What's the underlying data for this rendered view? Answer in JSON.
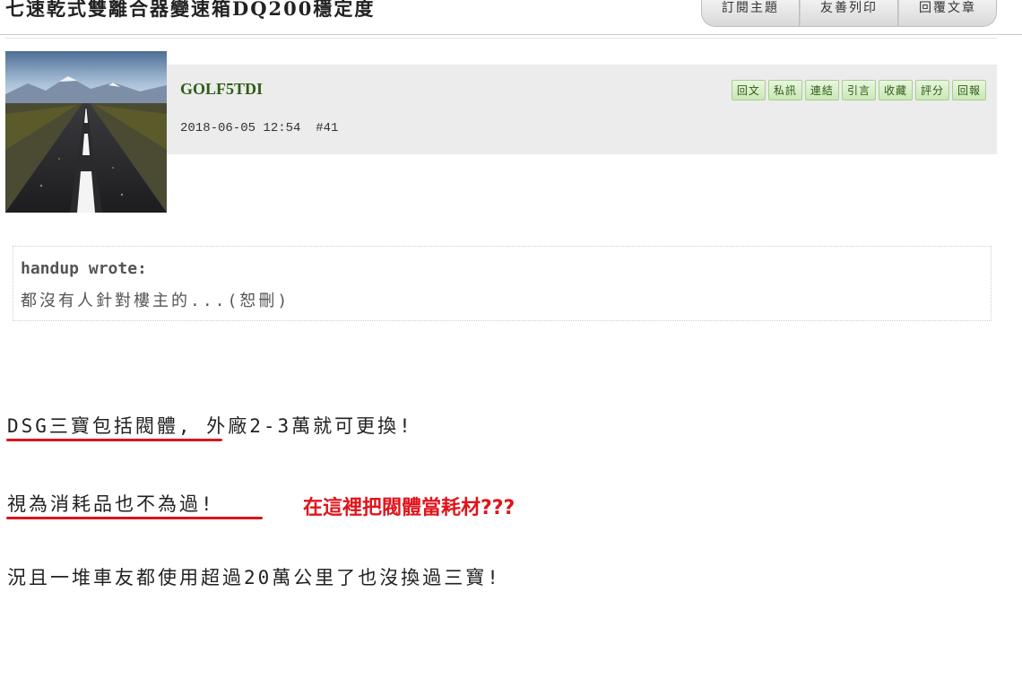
{
  "topic": {
    "title": "七速乾式雙離合器變速箱DQ200穩定度",
    "actions": [
      "訂閱主題",
      "友善列印",
      "回覆文章"
    ]
  },
  "post": {
    "username": "GOLF5TDI",
    "datetime": "2018-06-05 12:54",
    "floor": "#41",
    "actions": [
      "回文",
      "私訊",
      "連結",
      "引言",
      "收藏",
      "評分",
      "回報"
    ]
  },
  "quote": {
    "author": "handup wrote:",
    "text": "都沒有人針對樓主的...(恕刪)"
  },
  "content": {
    "line1": "DSG三寶包括閥體, 外廠2-3萬就可更換!",
    "line2": "視為消耗品也不為過!",
    "line3": "況且一堆車友都使用超過20萬公里了也沒換過三寶!"
  },
  "annotation": {
    "text": "在這裡把閥體當耗材???",
    "color": "#e0141c"
  },
  "colors": {
    "username": "#2f5d16",
    "header_bg": "#ececec",
    "underline": "#d9141f"
  }
}
